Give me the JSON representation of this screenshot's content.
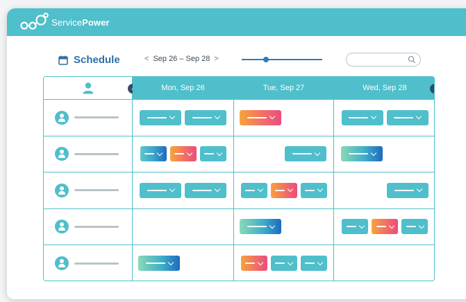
{
  "app": {
    "brand_light": "Service",
    "brand_bold": "Power"
  },
  "toolbar": {
    "title": "Schedule",
    "date_range": "Sep 26 – Sep 28",
    "prev_label": "<",
    "next_label": ">",
    "zoom_level": 0.3,
    "search_placeholder": ""
  },
  "columns": [
    "Mon, Sep 26",
    "Tue, Sep 27",
    "Wed, Sep 28"
  ],
  "nav": {
    "prev": "‹",
    "next": "›"
  },
  "colors": {
    "accent": "#4fbfcb",
    "primary": "#2e6fa6",
    "grid": "#4fbfcb"
  },
  "rows": [
    {
      "icon": "user-avatar-icon",
      "mon": [
        "teal-w60",
        "teal-w60"
      ],
      "tue": [
        "orange-w60"
      ],
      "wed": [
        "teal-w60",
        "teal-w60"
      ]
    },
    {
      "icon": "user-avatar-icon",
      "mon": [
        "tealblue-w40",
        "orange-w40",
        "teal-w40"
      ],
      "tue": [
        "teal-w60"
      ],
      "wed": [
        "tealblue-w60"
      ]
    },
    {
      "icon": "user-avatar-icon",
      "mon": [
        "teal-w60",
        "teal-w60"
      ],
      "tue": [
        "teal-w40",
        "orange-w40",
        "teal-w40"
      ],
      "wed": [
        "teal-w60"
      ]
    },
    {
      "icon": "user-avatar-icon",
      "mon": [],
      "tue": [
        "tealblue-w60"
      ],
      "wed": [
        "teal-w40",
        "orange-w40",
        "teal-w40"
      ]
    },
    {
      "icon": "user-avatar-icon",
      "mon": [
        "tealblue-w60"
      ],
      "tue": [
        "orange-w40",
        "teal-w40",
        "teal-w40"
      ],
      "wed": []
    }
  ]
}
